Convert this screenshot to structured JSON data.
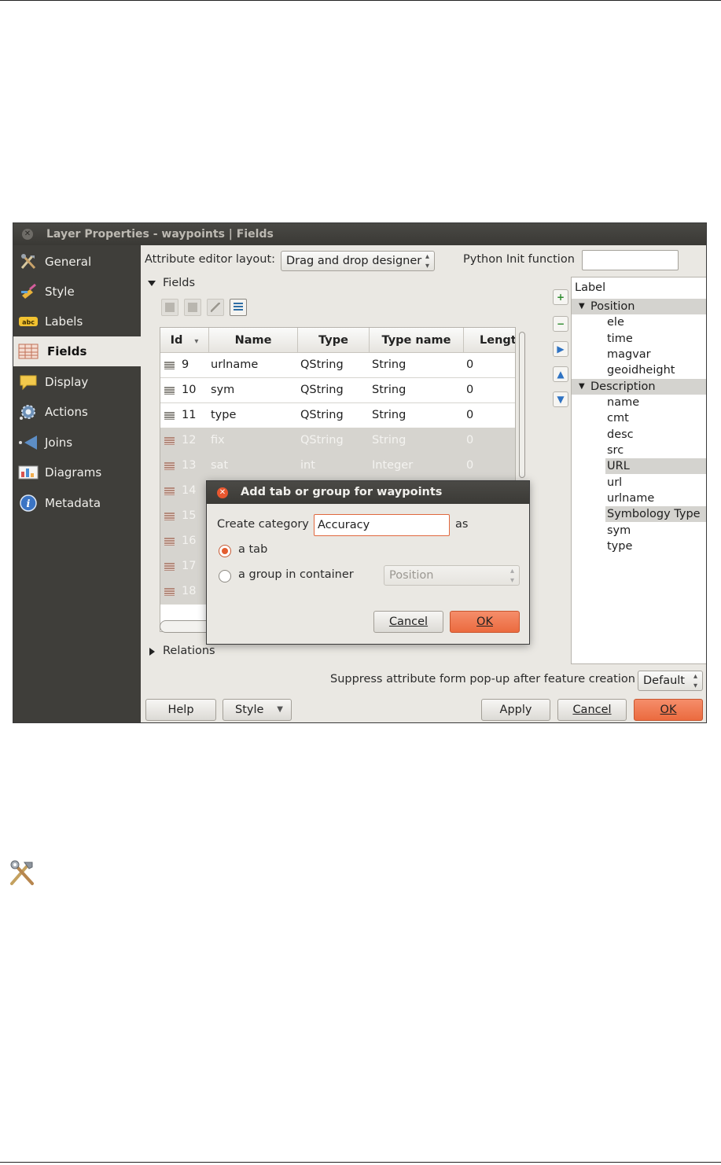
{
  "window": {
    "title": "Layer Properties - waypoints | Fields",
    "close_glyph": "✕"
  },
  "sidebar": {
    "items": [
      {
        "label": "General",
        "icon": "hammer-wrench-icon"
      },
      {
        "label": "Style",
        "icon": "paintbrush-icon"
      },
      {
        "label": "Labels",
        "icon": "abc-label-icon"
      },
      {
        "label": "Fields",
        "icon": "table-fields-icon",
        "active": true
      },
      {
        "label": "Display",
        "icon": "speech-bubble-icon"
      },
      {
        "label": "Actions",
        "icon": "gear-actions-icon"
      },
      {
        "label": "Joins",
        "icon": "join-arrow-icon"
      },
      {
        "label": "Diagrams",
        "icon": "chart-diagram-icon"
      },
      {
        "label": "Metadata",
        "icon": "info-icon"
      }
    ]
  },
  "attribute_editor": {
    "layout_label": "Attribute editor layout:",
    "layout_value": "Drag and drop designer",
    "python_init_label": "Python Init function",
    "python_init_value": ""
  },
  "fields_section": {
    "label": "Fields",
    "columns": [
      "Id",
      "Name",
      "Type",
      "Type name",
      "Lengt"
    ],
    "rows": [
      {
        "id": "9",
        "name": "urlname",
        "type": "QString",
        "type_name": "String",
        "length": "0",
        "dim": false
      },
      {
        "id": "10",
        "name": "sym",
        "type": "QString",
        "type_name": "String",
        "length": "0",
        "dim": false
      },
      {
        "id": "11",
        "name": "type",
        "type": "QString",
        "type_name": "String",
        "length": "0",
        "dim": false
      },
      {
        "id": "12",
        "name": "fix",
        "type": "QString",
        "type_name": "String",
        "length": "0",
        "dim": true
      },
      {
        "id": "13",
        "name": "sat",
        "type": "int",
        "type_name": "Integer",
        "length": "0",
        "dim": true
      },
      {
        "id": "14",
        "name": "",
        "type": "",
        "type_name": "",
        "length": "",
        "dim": true
      },
      {
        "id": "15",
        "name": "",
        "type": "",
        "type_name": "",
        "length": "",
        "dim": true
      },
      {
        "id": "16",
        "name": "",
        "type": "",
        "type_name": "",
        "length": "",
        "dim": true
      },
      {
        "id": "17",
        "name": "",
        "type": "",
        "type_name": "",
        "length": "",
        "dim": true
      },
      {
        "id": "18",
        "name": "",
        "type": "",
        "type_name": "",
        "length": "",
        "dim": true
      }
    ]
  },
  "tree": {
    "header": "Label",
    "items": [
      {
        "text": "Position",
        "level": 0,
        "expanded": true,
        "highlight": true
      },
      {
        "text": "ele",
        "level": 1
      },
      {
        "text": "time",
        "level": 1
      },
      {
        "text": "magvar",
        "level": 1
      },
      {
        "text": "geoidheight",
        "level": 1
      },
      {
        "text": "Description",
        "level": 0,
        "expanded": true,
        "highlight": true
      },
      {
        "text": "name",
        "level": 1
      },
      {
        "text": "cmt",
        "level": 1
      },
      {
        "text": "desc",
        "level": 1
      },
      {
        "text": "src",
        "level": 1
      },
      {
        "text": "URL",
        "level": 1,
        "highlight": true
      },
      {
        "text": "url",
        "level": 1
      },
      {
        "text": "urlname",
        "level": 1
      },
      {
        "text": "Symbology Type",
        "level": 1,
        "highlight": true
      },
      {
        "text": "sym",
        "level": 1
      },
      {
        "text": "type",
        "level": 1
      }
    ]
  },
  "relations": {
    "label": "Relations"
  },
  "suppress": {
    "label": "Suppress attribute form pop-up after feature creation",
    "value": "Default"
  },
  "footer": {
    "help": "Help",
    "style": "Style",
    "apply": "Apply",
    "cancel": "Cancel",
    "ok": "OK"
  },
  "dialog": {
    "title": "Add tab or group for waypoints",
    "create_category_label": "Create category",
    "category_value": "Accuracy",
    "as_label": "as",
    "option_tab": "a tab",
    "option_group": "a group in container",
    "container_value": "Position",
    "cancel": "Cancel",
    "ok": "OK"
  },
  "colors": {
    "accent": "#eb6b3f",
    "sidebar_bg": "#3f3e3a",
    "window_bg": "#eae8e3"
  }
}
